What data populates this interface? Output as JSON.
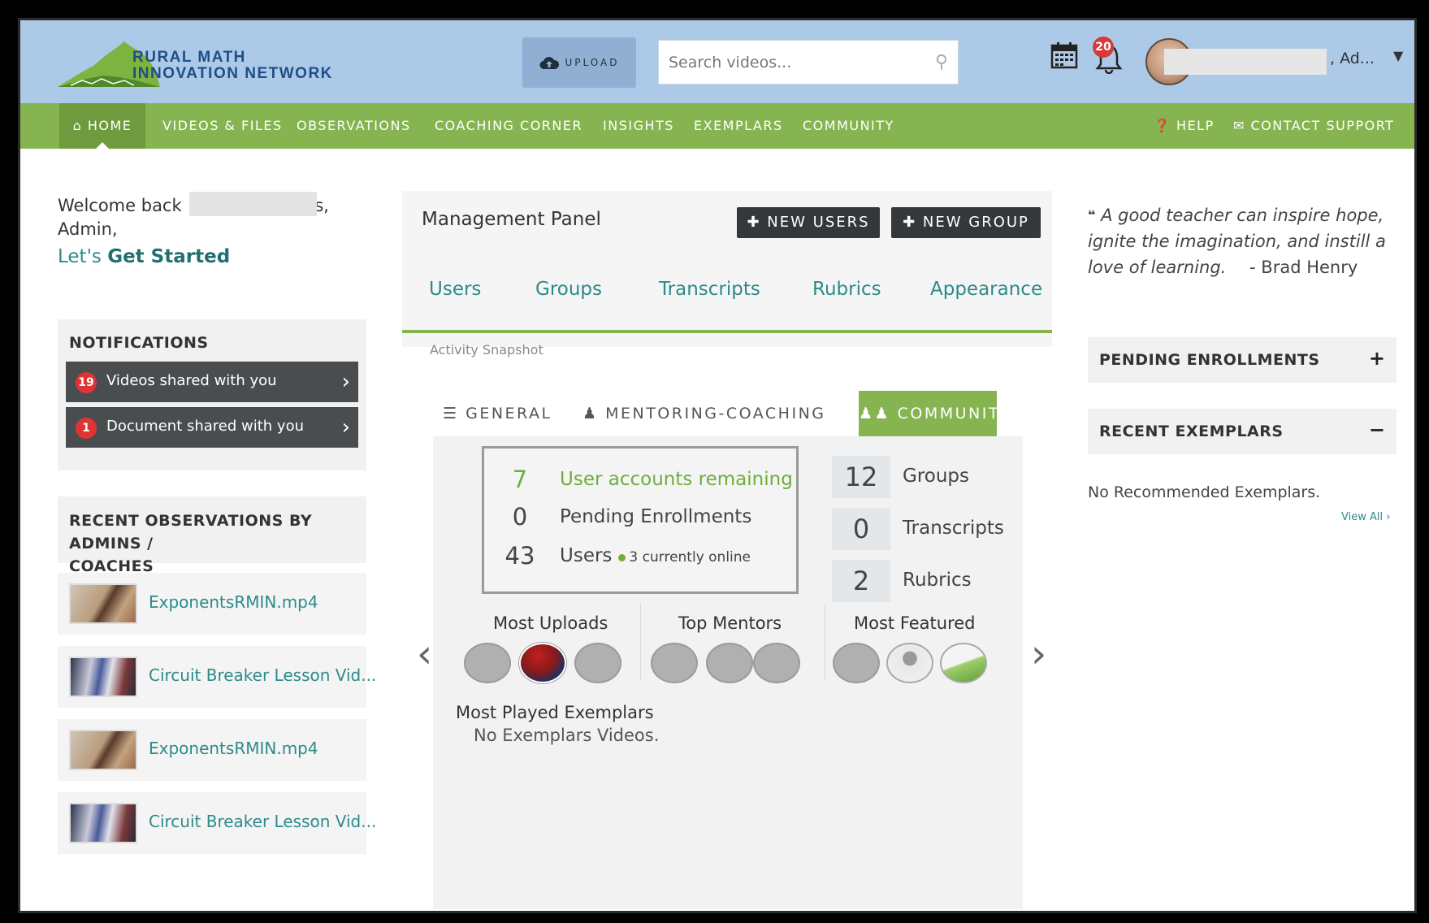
{
  "header": {
    "logo_line1": "RURAL MATH",
    "logo_line2": "INNOVATION NETWORK",
    "upload_label": "UPLOAD",
    "search_placeholder": "Search videos...",
    "notification_count": "20",
    "user_name": ", Ad..."
  },
  "nav": {
    "home": "HOME",
    "items": [
      "VIDEOS & FILES",
      "OBSERVATIONS",
      "COACHING CORNER",
      "INSIGHTS",
      "EXEMPLARS",
      "COMMUNITY"
    ],
    "help": "HELP",
    "contact": "CONTACT SUPPORT"
  },
  "welcome": {
    "line1_prefix": "Welcome back ",
    "line1_suffix": "s,",
    "line2": "Admin,",
    "lets": "Let's ",
    "get_started": "Get Started"
  },
  "notifications": {
    "title": "NOTIFICATIONS",
    "items": [
      {
        "count": "19",
        "label": "Videos shared with you"
      },
      {
        "count": "1",
        "label": "Document shared with you"
      }
    ]
  },
  "observations": {
    "title_line1": "RECENT OBSERVATIONS BY ADMINS /",
    "title_line2": "COACHES",
    "items": [
      "ExponentsRMIN.mp4",
      "Circuit Breaker Lesson Vid...",
      "ExponentsRMIN.mp4",
      "Circuit Breaker Lesson Vid..."
    ]
  },
  "management": {
    "title": "Management Panel",
    "new_users": "NEW USERS",
    "new_group": "NEW GROUP",
    "tabs": [
      "Users",
      "Groups",
      "Transcripts",
      "Rubrics",
      "Appearance"
    ],
    "activity_label": "Activity Snapshot",
    "subtabs": {
      "general": "GENERAL",
      "mentoring": "MENTORING-COACHING",
      "community": "COMMUNITY"
    },
    "stats": {
      "remaining_num": "7",
      "remaining_label": "User accounts remaining",
      "pending_num": "0",
      "pending_label": "Pending Enrollments",
      "users_num": "43",
      "users_label": "Users",
      "online_label": "3 currently online"
    },
    "counts": [
      {
        "num": "12",
        "label": "Groups"
      },
      {
        "num": "0",
        "label": "Transcripts"
      },
      {
        "num": "2",
        "label": "Rubrics"
      }
    ],
    "columns": {
      "uploads": "Most Uploads",
      "mentors": "Top Mentors",
      "featured": "Most Featured"
    },
    "most_played_title": "Most Played Exemplars",
    "most_played_empty": "No Exemplars Videos."
  },
  "quote": {
    "text": "A good teacher can inspire hope, ignite the imagination, and instill a love of learning.",
    "author": "- Brad Henry"
  },
  "right": {
    "pending_title": "PENDING ENROLLMENTS",
    "pending_sign": "+",
    "exemplars_title": "RECENT EXEMPLARS",
    "exemplars_sign": "−",
    "no_recommended": "No Recommended Exemplars.",
    "view_all": "View All"
  },
  "colors": {
    "header_bg": "#adc9e8",
    "nav_bg": "#86b451",
    "accent_teal": "#2d8a8a",
    "dark_button": "#33383b",
    "badge_red": "#e03434"
  }
}
